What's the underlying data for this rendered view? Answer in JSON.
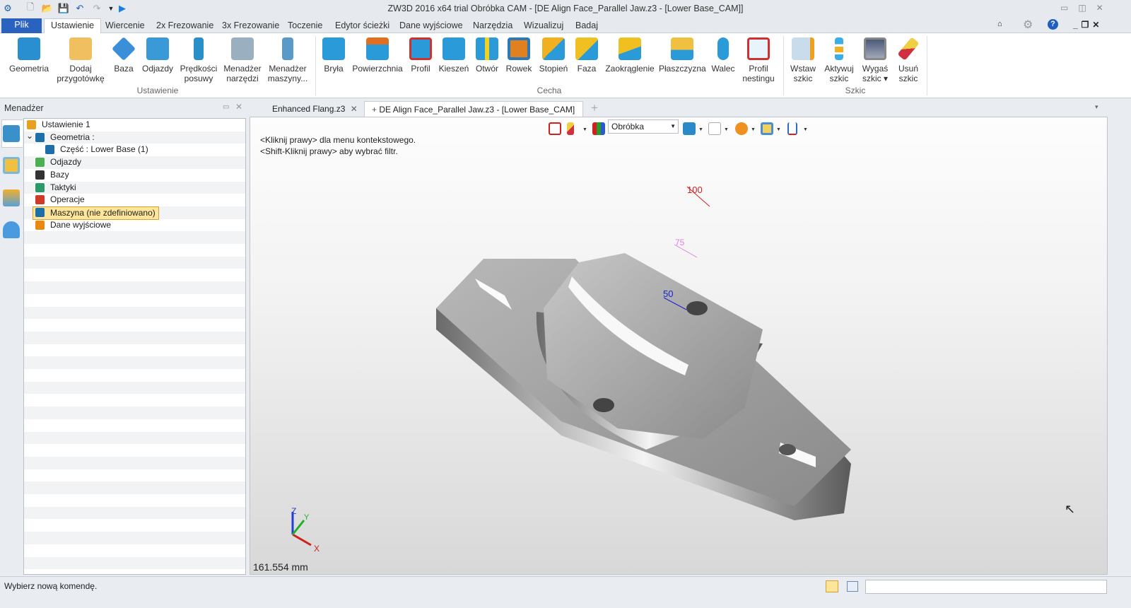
{
  "titlebar": {
    "title": "ZW3D 2016  x64 trial     Obróbka CAM - [DE Align Face_Parallel Jaw.z3 - [Lower Base_CAM]]"
  },
  "menu": {
    "file": "Plik",
    "tabs": [
      "Ustawienie",
      "Wiercenie",
      "2x Frezowanie",
      "3x Frezowanie",
      "Toczenie",
      "Edytor ścieżki",
      "Dane wyjściowe",
      "Narzędzia",
      "Wizualizuj",
      "Badaj"
    ]
  },
  "ribbon": {
    "groups": {
      "setup": "Ustawienie",
      "feature": "Cecha",
      "sketch": "Szkic"
    },
    "setup": [
      {
        "l1": "Geometria",
        "l2": ""
      },
      {
        "l1": "Dodaj",
        "l2": "przygotówkę"
      },
      {
        "l1": "Baza",
        "l2": ""
      },
      {
        "l1": "Odjazdy",
        "l2": ""
      },
      {
        "l1": "Prędkości",
        "l2": "posuwy"
      },
      {
        "l1": "Menadżer",
        "l2": "narzędzi"
      },
      {
        "l1": "Menadżer",
        "l2": "maszyny..."
      }
    ],
    "feature": [
      {
        "l1": "Bryła",
        "l2": ""
      },
      {
        "l1": "Powierzchnia",
        "l2": ""
      },
      {
        "l1": "Profil",
        "l2": ""
      },
      {
        "l1": "Kieszeń",
        "l2": ""
      },
      {
        "l1": "Otwór",
        "l2": ""
      },
      {
        "l1": "Rowek",
        "l2": ""
      },
      {
        "l1": "Stopień",
        "l2": ""
      },
      {
        "l1": "Faza",
        "l2": ""
      },
      {
        "l1": "Zaokrąglenie",
        "l2": ""
      },
      {
        "l1": "Płaszczyzna",
        "l2": ""
      },
      {
        "l1": "Walec",
        "l2": ""
      },
      {
        "l1": "Profil",
        "l2": "nestingu"
      }
    ],
    "sketch": [
      {
        "l1": "Wstaw",
        "l2": "szkic"
      },
      {
        "l1": "Aktywuj",
        "l2": "szkic"
      },
      {
        "l1": "Wygaś",
        "l2": "szkic ▾"
      },
      {
        "l1": "Usuń",
        "l2": "szkic"
      }
    ]
  },
  "manager": {
    "title": "Menadżer",
    "tree": [
      {
        "label": "Ustawienie 1",
        "indent": 0,
        "color": "#e8a020"
      },
      {
        "label": "Geometria :",
        "indent": 1,
        "color": "#1c6fa8",
        "expander": "⌄"
      },
      {
        "label": "Część : Lower Base (1)",
        "indent": 2,
        "color": "#1c6fa8"
      },
      {
        "label": "Odjazdy",
        "indent": 1,
        "color": "#4caf50"
      },
      {
        "label": "Bazy",
        "indent": 1,
        "color": "#333"
      },
      {
        "label": "Taktyki",
        "indent": 1,
        "color": "#2a9a6a"
      },
      {
        "label": "Operacje",
        "indent": 1,
        "color": "#d03a2a"
      },
      {
        "label": "Maszyna (nie zdefiniowano)",
        "indent": 1,
        "color": "#1c6fa8",
        "selected": true
      },
      {
        "label": "Dane wyjściowe",
        "indent": 1,
        "color": "#e88a10"
      }
    ]
  },
  "doc_tabs": [
    {
      "label": "Enhanced Flang.z3"
    },
    {
      "label": "DE Align Face_Parallel Jaw.z3 - [Lower Base_CAM]",
      "active": true
    }
  ],
  "viewport": {
    "filter_value": "Obróbka",
    "hint1": "<Kliknij prawy> dla menu kontekstowego.",
    "hint2": "<Shift-Kliknij prawy> aby wybrać filtr.",
    "scale": "161.554 mm",
    "dims": [
      "100",
      "75",
      "50"
    ],
    "axes": {
      "x": "X",
      "y": "Y",
      "z": "Z"
    }
  },
  "status": {
    "text": "Wybierz nową komendę.",
    "input_value": ""
  },
  "colors": {
    "accent": "#2a62c0",
    "selection": "#fde59a"
  }
}
